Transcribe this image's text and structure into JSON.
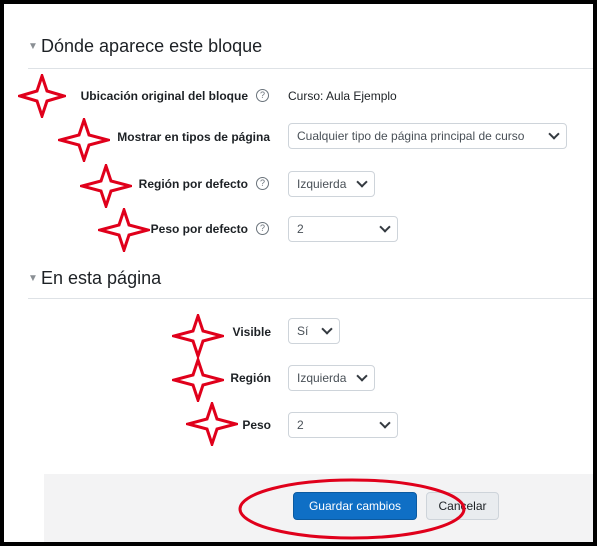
{
  "sections": {
    "where": {
      "title": "Dónde aparece este bloque",
      "original_location_label": "Ubicación original del bloque",
      "original_location_value": "Curso: Aula Ejemplo",
      "page_types_label": "Mostrar en tipos de página",
      "page_types_value": "Cualquier tipo de página principal de curso",
      "default_region_label": "Región por defecto",
      "default_region_value": "Izquierda",
      "default_weight_label": "Peso por defecto",
      "default_weight_value": "2"
    },
    "this_page": {
      "title": "En esta página",
      "visible_label": "Visible",
      "visible_value": "Sí",
      "region_label": "Región",
      "region_value": "Izquierda",
      "weight_label": "Peso",
      "weight_value": "2"
    }
  },
  "buttons": {
    "save": "Guardar cambios",
    "cancel": "Cancelar"
  },
  "help_glyph": "?",
  "colors": {
    "primary": "#0f6fc5",
    "annotation": "#e0001b",
    "footer": "#f3f3f4"
  }
}
